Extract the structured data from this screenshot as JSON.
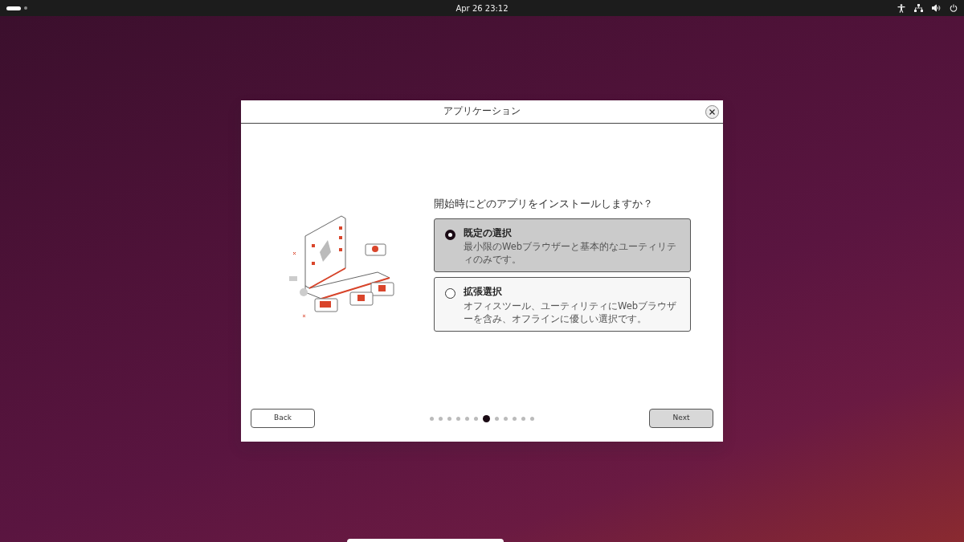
{
  "top_bar": {
    "workspaces": [
      {
        "selected": true
      },
      {
        "selected": false
      }
    ],
    "clock": "Apr 26  23:12"
  },
  "dialog": {
    "title": "アプリケーション",
    "question": "開始時にどのアプリをインストールしますか？",
    "options": [
      {
        "title": "既定の選択",
        "description": "最小限のWebブラウザーと基本的なユーティリティのみです。",
        "selected": true
      },
      {
        "title": "拡張選択",
        "description": "オフィスツール、ユーティリティにWebブラウザーを含み、オフラインに優しい選択です。",
        "selected": false
      }
    ],
    "pages": [
      {
        "selected": false
      },
      {
        "selected": false
      },
      {
        "selected": false
      },
      {
        "selected": false
      },
      {
        "selected": false
      },
      {
        "selected": false
      },
      {
        "selected": true
      },
      {
        "selected": false
      },
      {
        "selected": false
      },
      {
        "selected": false
      },
      {
        "selected": false
      },
      {
        "selected": false
      }
    ],
    "back_button": "Back",
    "next_button": "Next"
  }
}
